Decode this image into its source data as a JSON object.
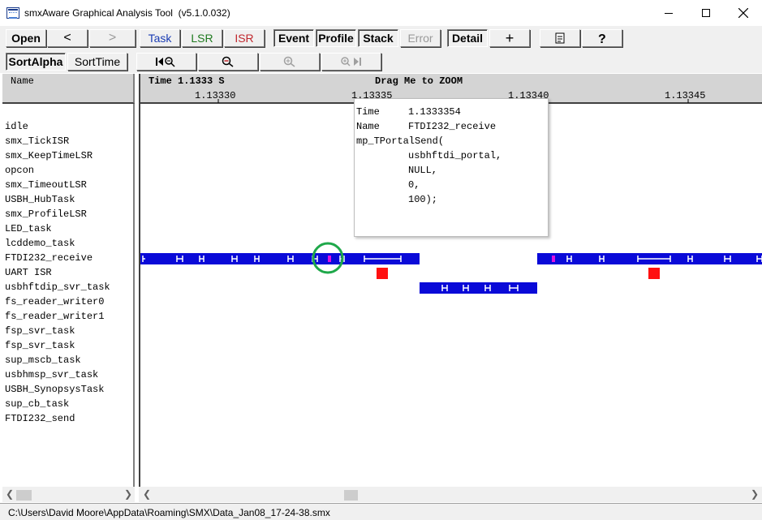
{
  "window": {
    "title": "smxAware Graphical Analysis Tool",
    "version": "(v5.1.0.032)",
    "controls": [
      "minimize",
      "maximize",
      "close"
    ]
  },
  "toolbar1": {
    "open": "Open",
    "back": "<",
    "forward": ">",
    "task": "Task",
    "lsr": "LSR",
    "isr": "ISR",
    "event": "Event",
    "profile": "Profile",
    "stack": "Stack",
    "error": "Error",
    "detail": "Detail",
    "add": "+"
  },
  "toolbar2": {
    "sort_alpha": "SortAlpha",
    "sort_time": "SortTime"
  },
  "header": {
    "name_col": "Name",
    "time_label": "Time 1.1333 S",
    "zoom_hint": "Drag Me to ZOOM",
    "ticks": [
      "1.13330",
      "1.13335",
      "1.13340",
      "1.13345"
    ]
  },
  "tasks": [
    "idle",
    "smx_TickISR",
    "smx_KeepTimeLSR",
    "opcon",
    "smx_TimeoutLSR",
    "USBH_HubTask",
    "smx_ProfileLSR",
    "LED_task",
    "lcddemo_task",
    "FTDI232_receive",
    "UART ISR",
    "usbhftdip_svr_task",
    "fs_reader_writer0",
    "fs_reader_writer1",
    "fsp_svr_task",
    "fsp_svr_task",
    "sup_mscb_task",
    "usbhmsp_svr_task",
    "USBH_SynopsysTask",
    "sup_cb_task",
    "FTDI232_send"
  ],
  "tooltip": {
    "time_key": "Time",
    "time_val": "1.1333354",
    "name_key": "Name",
    "name_val": "FTDI232_receive",
    "call": "mp_TPortalSend(",
    "arg1": "usbhftdi_portal,",
    "arg2": "NULL,",
    "arg3": "0,",
    "arg4": "100);"
  },
  "colors": {
    "task_bar": "#0a0ad8",
    "isr_block": "#ff1010",
    "event_marker": "#e010e0",
    "highlight_circle": "#1fa84a"
  },
  "status_bar": {
    "path": "C:\\Users\\David Moore\\AppData\\Roaming\\SMX\\Data_Jan08_17-24-38.smx"
  }
}
